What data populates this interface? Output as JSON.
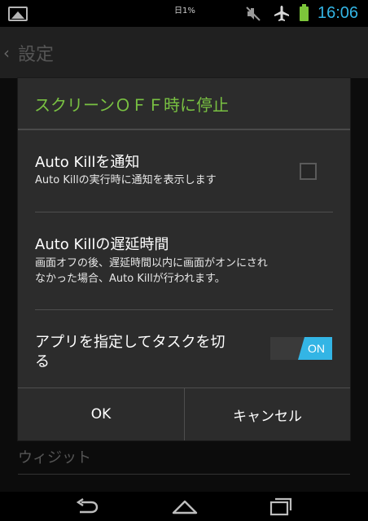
{
  "status_bar": {
    "battery_percent_label": "日1%",
    "time": "16:06",
    "icons": [
      "gallery-icon",
      "mute-icon",
      "airplane-icon",
      "battery-icon"
    ],
    "time_color": "#33b5e5",
    "battery_color": "#7cc63a"
  },
  "app_bar": {
    "title": "設定"
  },
  "background": {
    "section_label": "ウィジット"
  },
  "dialog": {
    "title": "スクリーンＯＦＦ時に停止",
    "title_color": "#79c142",
    "items": [
      {
        "title": "Auto Killを通知",
        "summary": "Auto Killの実行時に通知を表示します",
        "control": "checkbox",
        "checked": false
      },
      {
        "title": "Auto Killの遅延時間",
        "summary_line1": "画面オフの後、遅延時間以内に画面がオンにされ",
        "summary_line2": "なかった場合、Auto Killが行われます。"
      },
      {
        "title_line1": "アプリを指定してタスクを切",
        "title_line2": "る",
        "control": "toggle",
        "toggle_label": "ON",
        "toggle_color": "#33b5e5"
      }
    ],
    "buttons": {
      "ok": "OK",
      "cancel": "キャンセル"
    }
  },
  "nav_bar": {
    "icons": [
      "back-icon",
      "home-icon",
      "recent-apps-icon"
    ]
  }
}
